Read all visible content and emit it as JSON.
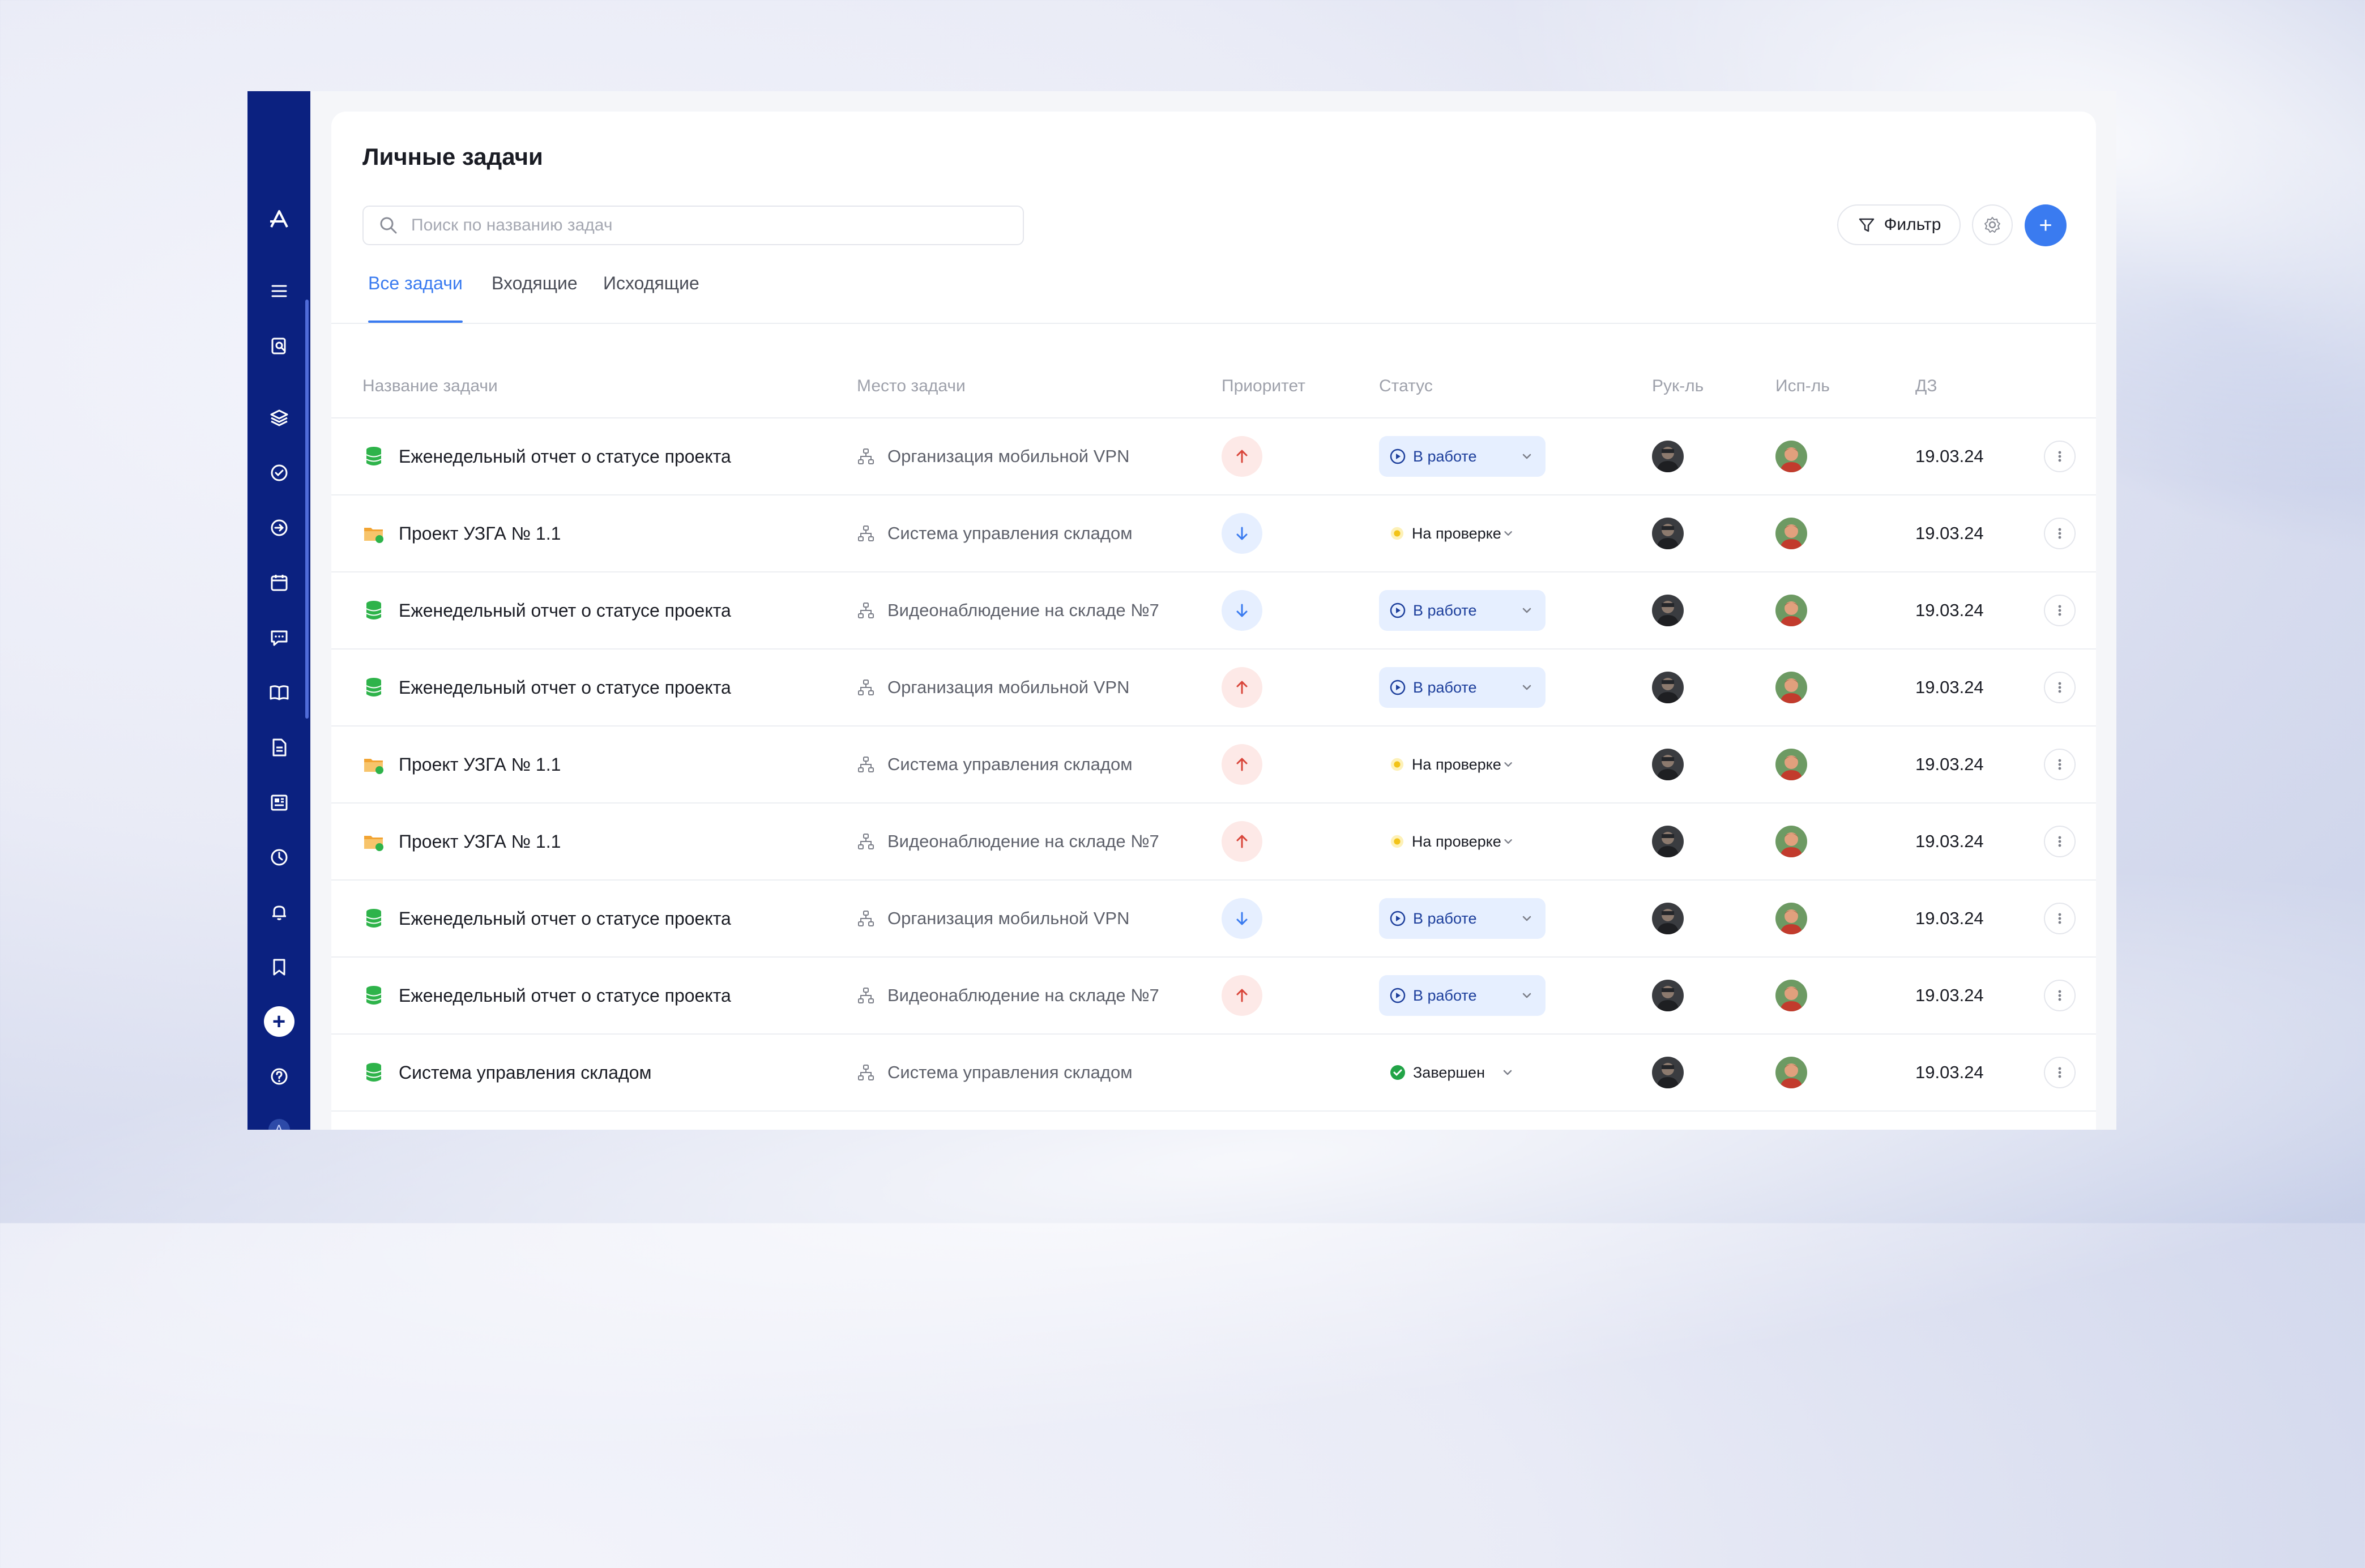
{
  "page": {
    "title": "Личные задачи"
  },
  "sidebar": {
    "items": [
      {
        "icon": "logo-icon"
      },
      {
        "icon": "menu-icon"
      },
      {
        "icon": "search-doc-icon"
      },
      {
        "icon": "layers-icon"
      },
      {
        "icon": "check-circle-icon"
      },
      {
        "icon": "arrow-right-circle-icon"
      },
      {
        "icon": "calendar-icon"
      },
      {
        "icon": "chat-icon"
      },
      {
        "icon": "book-icon"
      },
      {
        "icon": "document-icon"
      },
      {
        "icon": "news-icon"
      },
      {
        "icon": "clock-icon"
      },
      {
        "icon": "bell-icon"
      },
      {
        "icon": "bookmark-icon"
      },
      {
        "icon": "plus-icon"
      },
      {
        "icon": "help-icon"
      },
      {
        "icon": "mini-logo-icon"
      },
      {
        "icon": "user-avatar"
      }
    ],
    "plus_label": "+",
    "mini_logo": "A"
  },
  "search": {
    "placeholder": "Поиск по названию задач",
    "value": ""
  },
  "toolbar": {
    "filter_label": "Фильтр",
    "add_label": "+"
  },
  "tabs": [
    {
      "label": "Все задачи",
      "active": true
    },
    {
      "label": "Входящие",
      "active": false
    },
    {
      "label": "Исходящие",
      "active": false
    }
  ],
  "table": {
    "columns": [
      "Название задачи",
      "Место задачи",
      "Приоритет",
      "Статус",
      "Рук-ль",
      "Исп-ль",
      "ДЗ"
    ],
    "rows": [
      {
        "name": "Еженедельный отчет о статусе проекта",
        "type": "database-icon",
        "place": "Организация мобильной VPN",
        "priority": "high",
        "status": "В работе",
        "status_kind": "inwork",
        "date": "19.03.24"
      },
      {
        "name": "Проект УЗГА № 1.1",
        "type": "folder-icon",
        "place": "Система управления складом",
        "priority": "low",
        "status": "На проверке",
        "status_kind": "review",
        "date": "19.03.24"
      },
      {
        "name": "Еженедельный отчет о статусе проекта",
        "type": "database-icon",
        "place": "Видеонаблюдение на складе №7",
        "priority": "low",
        "status": "В работе",
        "status_kind": "inwork",
        "date": "19.03.24"
      },
      {
        "name": "Еженедельный отчет о статусе проекта",
        "type": "database-icon",
        "place": "Организация мобильной VPN",
        "priority": "high",
        "status": "В работе",
        "status_kind": "inwork",
        "date": "19.03.24"
      },
      {
        "name": "Проект УЗГА № 1.1",
        "type": "folder-icon",
        "place": "Система управления складом",
        "priority": "high",
        "status": "На проверке",
        "status_kind": "review",
        "date": "19.03.24"
      },
      {
        "name": "Проект УЗГА № 1.1",
        "type": "folder-icon",
        "place": "Видеонаблюдение на складе №7",
        "priority": "high",
        "status": "На проверке",
        "status_kind": "review",
        "date": "19.03.24"
      },
      {
        "name": "Еженедельный отчет о статусе проекта",
        "type": "database-icon",
        "place": "Организация мобильной VPN",
        "priority": "low",
        "status": "В работе",
        "status_kind": "inwork",
        "date": "19.03.24"
      },
      {
        "name": "Еженедельный отчет о статусе проекта",
        "type": "database-icon",
        "place": "Видеонаблюдение на складе №7",
        "priority": "high",
        "status": "В работе",
        "status_kind": "inwork",
        "date": "19.03.24"
      },
      {
        "name": "Система управления складом",
        "type": "database-icon",
        "place": "Система управления складом",
        "priority": "none",
        "status": "Завершен",
        "status_kind": "done",
        "date": "19.03.24"
      }
    ]
  },
  "colors": {
    "sidebar": "#0b2180",
    "accent": "#3a7bf0",
    "priority_high_bg": "#fde9e7",
    "priority_high_fg": "#d9463b",
    "priority_low_bg": "#e6efff",
    "priority_low_fg": "#3a7bf0",
    "status_inwork_bg": "#e6efff",
    "status_review": "#f2c318",
    "status_done": "#22a447",
    "db_icon": "#2eb34a",
    "folder_icon": "#f2a433"
  }
}
